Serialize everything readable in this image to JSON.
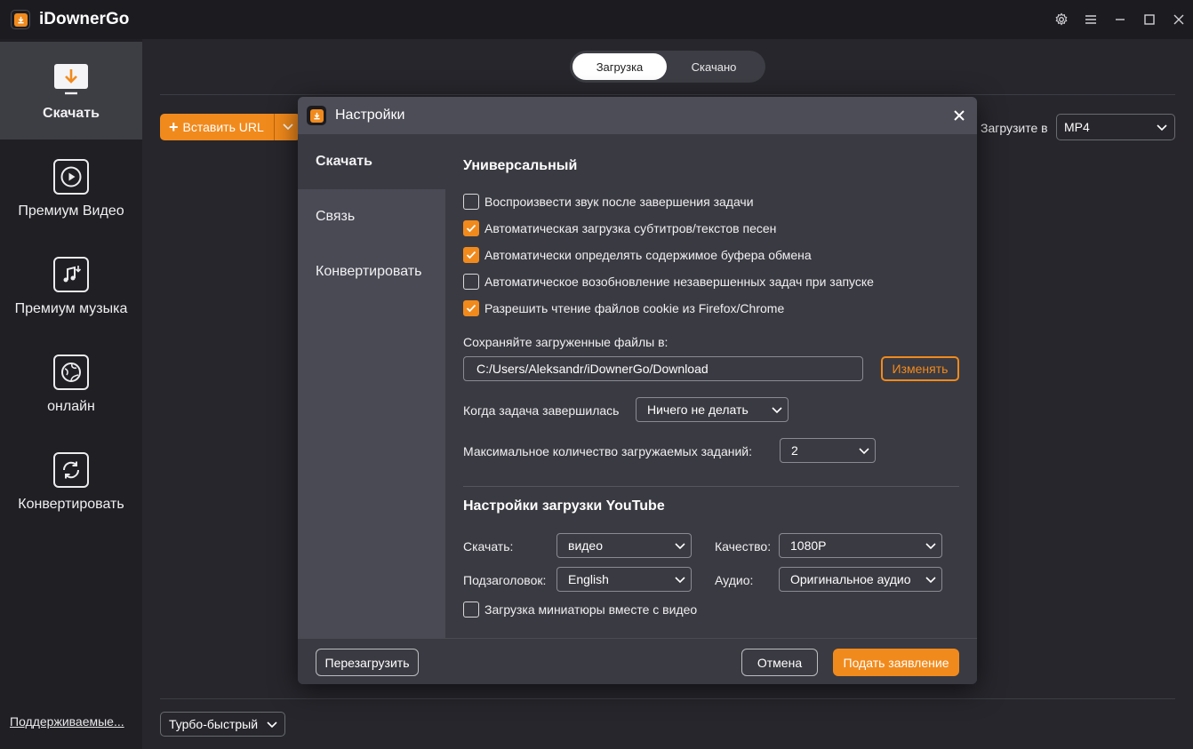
{
  "app": {
    "title": "iDownerGo"
  },
  "sidebar": {
    "items": [
      {
        "label": "Скачать",
        "icon": "download-icon"
      },
      {
        "label": "Премиум Видео",
        "icon": "play-icon"
      },
      {
        "label": "Премиум музыка",
        "icon": "music-icon"
      },
      {
        "label": "онлайн",
        "icon": "globe-icon"
      },
      {
        "label": "Конвертировать",
        "icon": "convert-icon"
      }
    ],
    "support_link": "Поддерживаемые..."
  },
  "main": {
    "tabs": [
      {
        "label": "Загрузка"
      },
      {
        "label": "Скачано"
      }
    ],
    "paste_url_label": "Вставить URL",
    "download_to_label": "Загрузите в",
    "format_value": "MP4",
    "turbo_value": "Турбо-быстрый"
  },
  "dialog": {
    "title": "Настройки",
    "nav": [
      {
        "label": "Скачать"
      },
      {
        "label": "Связь"
      },
      {
        "label": "Конвертировать"
      }
    ],
    "general_title": "Универсальный",
    "checkboxes": [
      {
        "label": "Воспроизвести звук после завершения задачи",
        "checked": false
      },
      {
        "label": "Автоматическая загрузка субтитров/текстов песен",
        "checked": true
      },
      {
        "label": "Автоматически определять содержимое буфера обмена",
        "checked": true
      },
      {
        "label": "Автоматическое возобновление незавершенных задач при запуске",
        "checked": false
      },
      {
        "label": "Разрешить чтение файлов cookie из Firefox/Chrome",
        "checked": true
      }
    ],
    "save_path_label": "Сохраняйте загруженные файлы в:",
    "save_path_value": "C:/Users/Aleksandr/iDownerGo/Download",
    "change_button": "Изменять",
    "on_complete_label": "Когда задача завершилась",
    "on_complete_value": "Ничего не делать",
    "max_tasks_label": "Максимальное количество загружаемых заданий:",
    "max_tasks_value": "2",
    "youtube_title": "Настройки загрузки YouTube",
    "download_label": "Скачать:",
    "download_value": "видео",
    "quality_label": "Качество:",
    "quality_value": "1080P",
    "subtitle_label": "Подзаголовок:",
    "subtitle_value": "English",
    "audio_label": "Аудио:",
    "audio_value": "Оригинальное аудио",
    "thumbnail_checkbox": {
      "label": "Загрузка миниатюры вместе с видео",
      "checked": false
    },
    "reset_button": "Перезагрузить",
    "cancel_button": "Отмена",
    "submit_button": "Подать заявление"
  },
  "colors": {
    "accent": "#f18a1c",
    "background": "#26262c",
    "sidebar": "#1f1f24",
    "dialog": "#3a3a42"
  }
}
